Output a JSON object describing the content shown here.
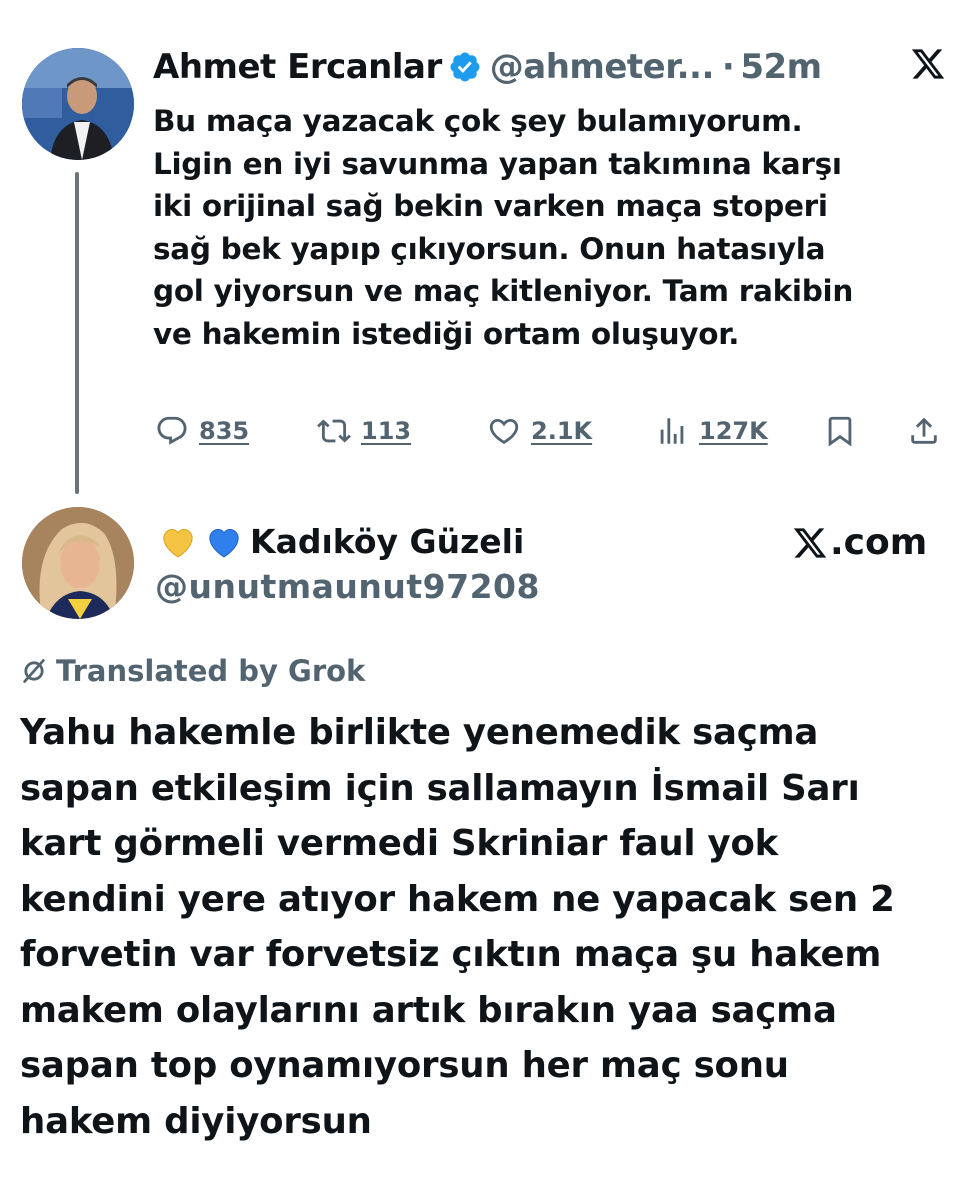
{
  "tweet1": {
    "author_name": "Ahmet Ercanlar",
    "handle": "@ahmeter...",
    "separator": "·",
    "time": "52m",
    "text": "Bu maça yazacak çok şey bulamıyorum.\nLigin en iyi savunma yapan takımına karşı\niki orijinal sağ bekin varken maça stoperi\nsağ bek yapıp çıkıyorsun. Onun hatasıyla\ngol yiyorsun ve maç kitleniyor. Tam rakibin\nve hakemin istediği ortam oluşuyor.",
    "actions": {
      "replies": "835",
      "retweets": "113",
      "likes": "2.1K",
      "views": "127K"
    },
    "colors": {
      "verified": "#1d9bf0",
      "muted": "#536471"
    }
  },
  "tweet2": {
    "author_name": "Kadıköy Güzeli",
    "emoji_icons": [
      "yellow-heart-icon",
      "blue-heart-icon"
    ],
    "handle": "@unutmaunut97208",
    "site": ".com",
    "translated_label": "Translated by Grok",
    "text": "Yahu hakemle birlikte yenemedik saçma\nsapan etkileşim için sallamayın İsmail Sarı\nkart görmeli vermedi Skriniar faul yok\nkendini yere atıyor hakem ne yapacak sen 2\nforvetin var forvetsiz çıktın maça şu hakem\nmakem olaylarını artık bırakın yaa saçma\nsapan top oynamıyorsun her maç sonu\nhakem diyiyorsun"
  }
}
